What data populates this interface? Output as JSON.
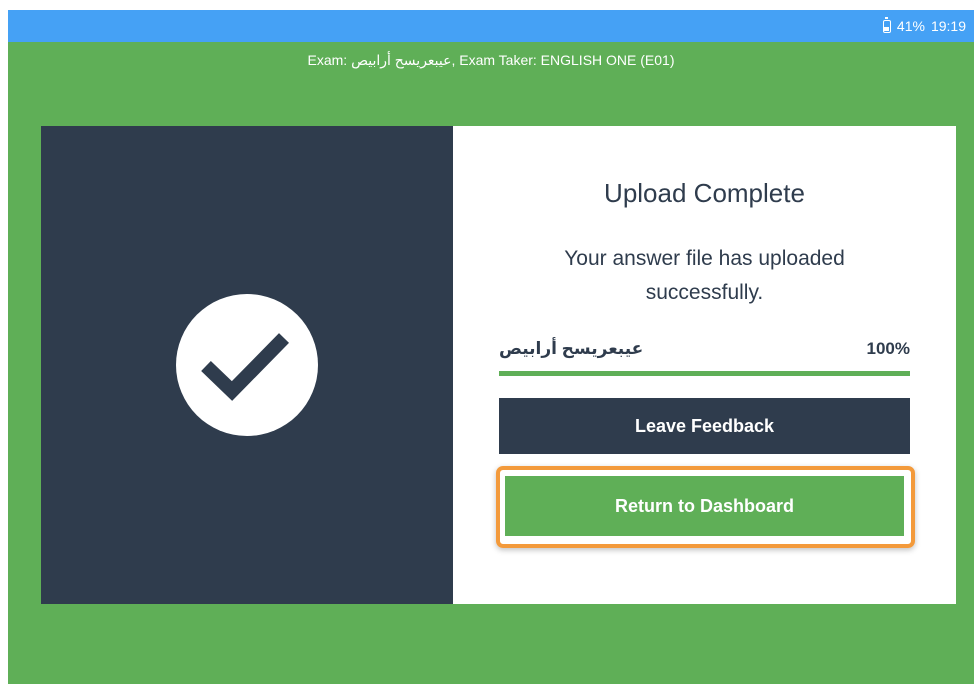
{
  "status_bar": {
    "battery_icon": "battery-charging-icon",
    "battery": "41%",
    "time": "19:19"
  },
  "header": {
    "exam_info": "Exam: عيبعريسح أرابيص, Exam Taker: ENGLISH ONE (E01)"
  },
  "left_panel": {
    "icon": "checkmark-circle-icon"
  },
  "upload": {
    "title": "Upload Complete",
    "message": "Your answer file has uploaded successfully.",
    "file_name": "عيبعريسح أرابيص",
    "progress_label": "100%",
    "progress_fraction": 1.0
  },
  "buttons": {
    "feedback_label": "Leave Feedback",
    "dashboard_label": "Return to Dashboard"
  },
  "colors": {
    "background_green": "#5faf57",
    "status_bar_blue": "#45a1f5",
    "dark_navy": "#2f3c4d",
    "highlight_orange": "#f39a3b"
  }
}
